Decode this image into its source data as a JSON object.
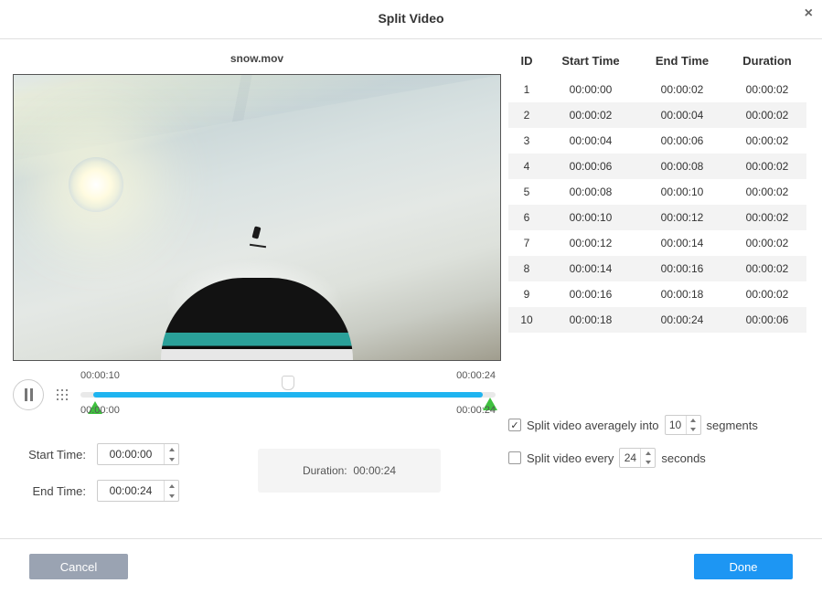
{
  "title": "Split Video",
  "filename": "snow.mov",
  "playhead": {
    "start_display": "00:00:10",
    "end_display": "00:00:24",
    "under_start": "00:00:00",
    "under_end": "00:00:24"
  },
  "form": {
    "start_label": "Start Time:",
    "start_value": "00:00:00",
    "end_label": "End Time:",
    "end_value": "00:00:24",
    "duration_label": "Duration:",
    "duration_value": "00:00:24"
  },
  "table": {
    "headers": {
      "id": "ID",
      "start": "Start Time",
      "end": "End Time",
      "duration": "Duration"
    },
    "rows": [
      {
        "id": "1",
        "start": "00:00:00",
        "end": "00:00:02",
        "duration": "00:00:02"
      },
      {
        "id": "2",
        "start": "00:00:02",
        "end": "00:00:04",
        "duration": "00:00:02"
      },
      {
        "id": "3",
        "start": "00:00:04",
        "end": "00:00:06",
        "duration": "00:00:02"
      },
      {
        "id": "4",
        "start": "00:00:06",
        "end": "00:00:08",
        "duration": "00:00:02"
      },
      {
        "id": "5",
        "start": "00:00:08",
        "end": "00:00:10",
        "duration": "00:00:02"
      },
      {
        "id": "6",
        "start": "00:00:10",
        "end": "00:00:12",
        "duration": "00:00:02"
      },
      {
        "id": "7",
        "start": "00:00:12",
        "end": "00:00:14",
        "duration": "00:00:02"
      },
      {
        "id": "8",
        "start": "00:00:14",
        "end": "00:00:16",
        "duration": "00:00:02"
      },
      {
        "id": "9",
        "start": "00:00:16",
        "end": "00:00:18",
        "duration": "00:00:02"
      },
      {
        "id": "10",
        "start": "00:00:18",
        "end": "00:00:24",
        "duration": "00:00:06"
      }
    ]
  },
  "options": {
    "average_label_pre": "Split video averagely into",
    "average_value": "10",
    "average_label_post": "segments",
    "average_checked": true,
    "every_label_pre": "Split video every",
    "every_value": "24",
    "every_label_post": "seconds",
    "every_checked": false
  },
  "buttons": {
    "cancel": "Cancel",
    "done": "Done"
  }
}
